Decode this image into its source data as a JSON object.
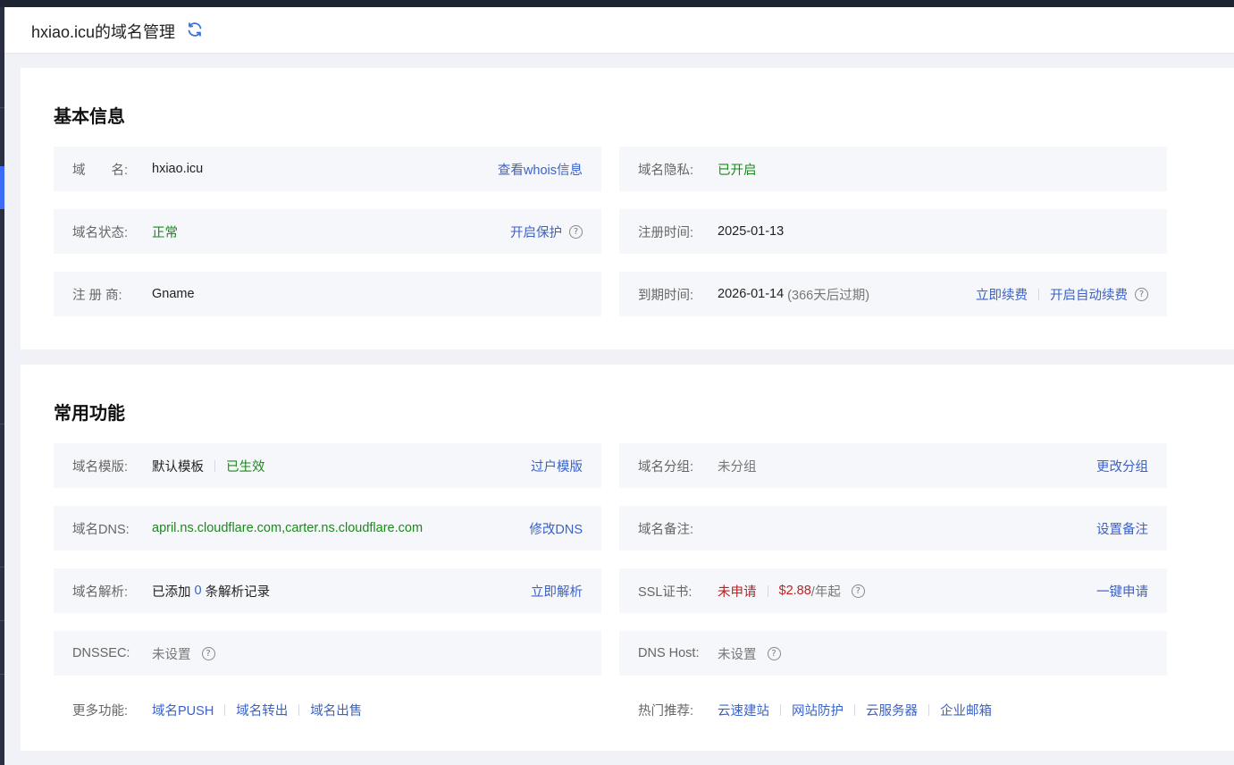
{
  "header": {
    "title": "hxiao.icu的域名管理",
    "refresh_icon": "refresh-icon"
  },
  "colors": {
    "accent_blue": "#3a62c8",
    "status_green": "#1b8a1b",
    "warn_red": "#c41d1d",
    "row_bg": "#f6f7fb",
    "page_bg": "#f0f2f7"
  },
  "basic": {
    "title": "基本信息",
    "domain": {
      "label": "域　　名:",
      "value": "hxiao.icu",
      "link": "查看whois信息"
    },
    "privacy": {
      "label": "域名隐私:",
      "value": "已开启"
    },
    "status": {
      "label": "域名状态:",
      "value": "正常",
      "link": "开启保护"
    },
    "reg_time": {
      "label": "注册时间:",
      "value": "2025-01-13"
    },
    "registrar": {
      "label": "注 册 商:",
      "value": "Gname"
    },
    "expire": {
      "label": "到期时间:",
      "value": "2026-01-14",
      "remaining": "(366天后过期)",
      "link_renew": "立即续费",
      "link_auto": "开启自动续费"
    }
  },
  "common": {
    "title": "常用功能",
    "template": {
      "label": "域名模版:",
      "value": "默认模板",
      "status": "已生效",
      "link": "过户模版"
    },
    "group": {
      "label": "域名分组:",
      "value": "未分组",
      "link": "更改分组"
    },
    "dns": {
      "label": "域名DNS:",
      "value": "april.ns.cloudflare.com,carter.ns.cloudflare.com",
      "link": "修改DNS"
    },
    "remark": {
      "label": "域名备注:",
      "value": "",
      "link": "设置备注"
    },
    "resolve": {
      "label": "域名解析:",
      "prefix": "已添加",
      "count": "0",
      "suffix": "条解析记录",
      "link": "立即解析"
    },
    "ssl": {
      "label": "SSL证书:",
      "status": "未申请",
      "price": "$2.88",
      "price_suffix": "/年起",
      "link": "一键申请"
    },
    "dnssec": {
      "label": "DNSSEC:",
      "value": "未设置"
    },
    "dnshost": {
      "label": "DNS Host:",
      "value": "未设置"
    },
    "more": {
      "label": "更多功能:",
      "items": [
        "域名PUSH",
        "域名转出",
        "域名出售"
      ]
    },
    "hot": {
      "label": "热门推荐:",
      "items": [
        "云速建站",
        "网站防护",
        "云服务器",
        "企业邮箱"
      ]
    }
  }
}
